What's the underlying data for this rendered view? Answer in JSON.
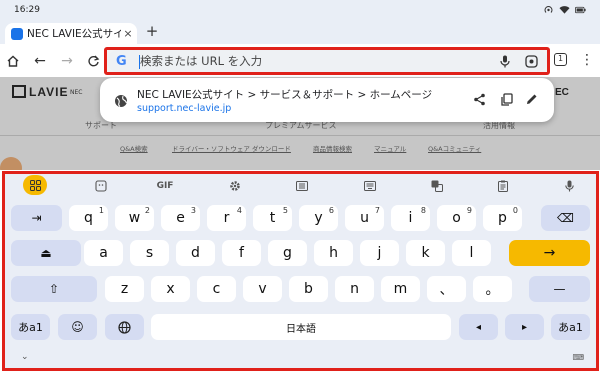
{
  "status": {
    "time": "16:29"
  },
  "tab": {
    "title": "NEC LAVIE公式サイ",
    "close": "×",
    "new_tab": "+"
  },
  "toolbar": {
    "home": "⌂",
    "back": "←",
    "forward": "→",
    "reload": "C",
    "omnibox_placeholder": "検索または URL を入力",
    "google_g": "G",
    "tab_count": "1",
    "menu": "⋮"
  },
  "page": {
    "logo": "LAVIE",
    "header_small": "NEC",
    "nec_right": "EC",
    "menu": [
      "サポート",
      "プレミアムサービス",
      "活用情報"
    ],
    "links": [
      "Q&A検索",
      "ドライバー・ソフトウェア ダウンロード",
      "商品情報検索",
      "マニュアル",
      "Q&Aコミュニティ"
    ]
  },
  "suggestion": {
    "title": "NEC LAVIE公式サイト > サービス＆サポート > ホームページ",
    "url": "support.nec-lavie.jp"
  },
  "keyboard": {
    "toolbar_gif": "GIF",
    "row1": [
      "⇥",
      "q",
      "w",
      "e",
      "r",
      "t",
      "y",
      "u",
      "i",
      "o",
      "p",
      "⌫"
    ],
    "row1_sup": [
      "",
      "1",
      "2",
      "3",
      "4",
      "5",
      "6",
      "7",
      "8",
      "9",
      "0",
      ""
    ],
    "row2": [
      "⏏",
      "a",
      "s",
      "d",
      "f",
      "g",
      "h",
      "j",
      "k",
      "l",
      "→"
    ],
    "row3": [
      "⇧",
      "z",
      "x",
      "c",
      "v",
      "b",
      "n",
      "m",
      "、",
      "。",
      "—"
    ],
    "row4": [
      "あa1",
      "☺",
      "🌐",
      "日本語",
      "◂",
      "▸",
      "あa1"
    ],
    "hide_chevron": "⌄",
    "kbd_icon": "⌨"
  },
  "colors": {
    "highlight": "#e0211a",
    "accent": "#f6b900",
    "link": "#1a73e8"
  }
}
